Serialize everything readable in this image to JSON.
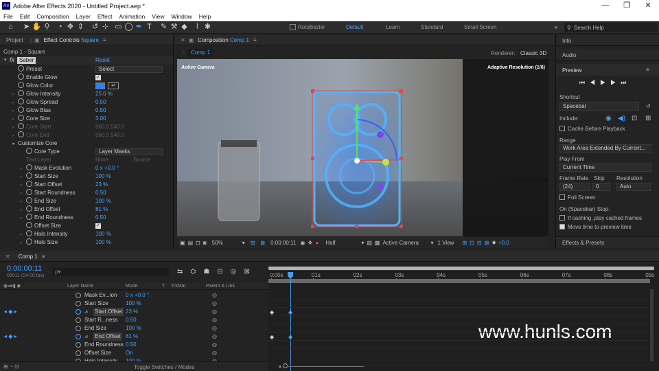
{
  "titlebar": {
    "app_label": "Ae",
    "title": "Adobe After Effects 2020 - Untitled Project.aep *",
    "minimize": "—",
    "maximize": "❐",
    "close": "✕"
  },
  "menu": [
    "File",
    "Edit",
    "Composition",
    "Layer",
    "Effect",
    "Animation",
    "View",
    "Window",
    "Help"
  ],
  "toolbar": {
    "rotobezier_label": "RotoBezier",
    "workspaces": [
      "Default",
      "Learn",
      "Standard",
      "Small Screen"
    ],
    "active_workspace": "Default",
    "more": "»",
    "search_placeholder": "Search Help"
  },
  "effect_controls": {
    "project_tab": "Project",
    "tab_label": "Effect Controls",
    "tab_layer": "Square",
    "menu": "≡",
    "breadcrumb": "Comp 1 - Square",
    "fx_label": "fx",
    "effect_name": "Saber",
    "reset_label": "Reset",
    "props": [
      {
        "name": "Preset",
        "value": "Select",
        "kind": "dropdown"
      },
      {
        "name": "Enable Glow",
        "value": "",
        "kind": "check"
      },
      {
        "name": "Glow Color",
        "value": "",
        "kind": "color"
      },
      {
        "name": "Glow Intensity",
        "value": "25.0 %",
        "kind": "value"
      },
      {
        "name": "Glow Spread",
        "value": "0.50",
        "kind": "value"
      },
      {
        "name": "Glow Bias",
        "value": "0.50",
        "kind": "value"
      },
      {
        "name": "Core Size",
        "value": "3.00",
        "kind": "value"
      },
      {
        "name": "Core Start",
        "value": "960.0,540.0",
        "kind": "dim"
      },
      {
        "name": "Core End",
        "value": "960.0,540.0",
        "kind": "dim"
      },
      {
        "name": "Customize Core",
        "value": "",
        "kind": "group"
      },
      {
        "name": "Core Type",
        "value": "Layer Masks",
        "kind": "dropdown"
      },
      {
        "name": "Text Layer",
        "value": "None",
        "value2": "Source",
        "kind": "dimdd"
      },
      {
        "name": "Mask Evolution",
        "value": "0 x +0.0 °",
        "kind": "value"
      },
      {
        "name": "Start Size",
        "value": "100 %",
        "kind": "value"
      },
      {
        "name": "Start Offset",
        "value": "23 %",
        "kind": "value"
      },
      {
        "name": "Start Roundness",
        "value": "0.50",
        "kind": "value"
      },
      {
        "name": "End Size",
        "value": "100 %",
        "kind": "value"
      },
      {
        "name": "End Offset",
        "value": "81 %",
        "kind": "value"
      },
      {
        "name": "End Roundness",
        "value": "0.50",
        "kind": "value"
      },
      {
        "name": "Offset Size",
        "value": "",
        "kind": "check"
      },
      {
        "name": "Halo Intensity",
        "value": "100 %",
        "kind": "value"
      },
      {
        "name": "Halo Size",
        "value": "100 %",
        "kind": "value"
      }
    ]
  },
  "composition": {
    "tab_label": "Composition",
    "tab_comp": "Comp 1",
    "menu": "≡",
    "comp_button": "Comp 1",
    "renderer_label": "Renderer:",
    "renderer_value": "Classic 3D",
    "active_camera": "Active Camera",
    "adaptive": "Adaptive Resolution (1/6)",
    "zoom": "50%",
    "timecode": "0:00:00:11",
    "quality": "Half",
    "camera_view": "Active Camera",
    "views": "1 View",
    "exposure": "+0.0"
  },
  "right_panel": {
    "info": "Info",
    "audio": "Audio",
    "preview": "Preview",
    "menu": "≡",
    "shortcut_label": "Shortcut",
    "shortcut_value": "Spacebar",
    "include_label": "Include:",
    "cache_label": "Cache Before Playback",
    "range_label": "Range",
    "range_value": "Work Area Extended By Current...",
    "play_from_label": "Play From",
    "play_from_value": "Current Time",
    "frame_rate_label": "Frame Rate",
    "skip_label": "Skip",
    "resolution_label": "Resolution",
    "frame_rate_value": "(24)",
    "skip_value": "0",
    "resolution_value": "Auto",
    "full_screen_label": "Full Screen",
    "stop_label": "On (Spacebar) Stop:",
    "if_caching_label": "If caching, play cached frames",
    "move_time_label": "Move time to preview time",
    "effects_presets": "Effects & Presets"
  },
  "timeline": {
    "tab_label": "Comp 1",
    "menu": "≡",
    "timecode": "0:00:00:11",
    "frame_info": "00011 (24.00 fps)",
    "search_placeholder": "ρ▾",
    "col_layer_name": "Layer Name",
    "col_mode": "Mode",
    "col_t": "T",
    "col_trkmat": "TrkMat",
    "col_parent": "Parent & Link",
    "rows": [
      {
        "name": "Mask Ev...ion",
        "value": "0 x +0.0 °",
        "key": false,
        "boxed": false
      },
      {
        "name": "Start Size",
        "value": "100 %",
        "key": false,
        "boxed": false
      },
      {
        "name": "Start Offset",
        "value": "23 %",
        "key": true,
        "boxed": true
      },
      {
        "name": "Start R...ness",
        "value": "0.50",
        "key": false,
        "boxed": false
      },
      {
        "name": "End Size",
        "value": "100 %",
        "key": false,
        "boxed": false
      },
      {
        "name": "End Offset",
        "value": "81 %",
        "key": true,
        "boxed": true
      },
      {
        "name": "End Roundness",
        "value": "0.50",
        "key": false,
        "boxed": false
      },
      {
        "name": "Offset Size",
        "value": "On",
        "key": false,
        "boxed": false
      },
      {
        "name": "Halo Intensity",
        "value": "100 %",
        "key": false,
        "boxed": false
      }
    ],
    "ruler": [
      "0:00s",
      "01s",
      "02s",
      "03s",
      "04s",
      "05s",
      "06s",
      "07s",
      "08s",
      "09s"
    ],
    "toggle_label": "Toggle Switches / Modes",
    "watermark": "www.hunls.com"
  },
  "colors": {
    "accent": "#4aa3ff",
    "glow": "#2a7fff",
    "playhead": "#4a9cf0"
  }
}
